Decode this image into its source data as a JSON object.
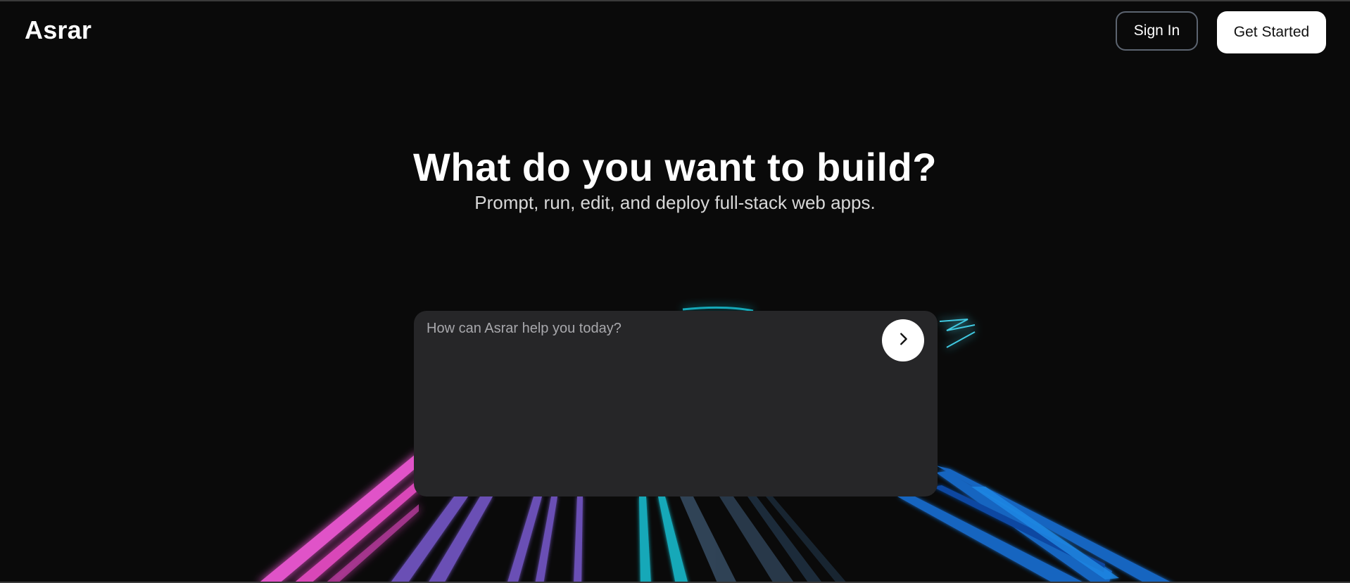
{
  "header": {
    "logo": "Asrar",
    "sign_in_label": "Sign In",
    "get_started_label": "Get Started"
  },
  "hero": {
    "title": "What do you want to build?",
    "subtitle": "Prompt, run, edit, and deploy full-stack web apps."
  },
  "prompt": {
    "placeholder": "How can Asrar help you today?",
    "value": "",
    "send_icon": "chevron-right-icon"
  },
  "colors": {
    "background": "#0a0a0a",
    "prompt_box": "#262628",
    "streak_pink": "#e052c8",
    "streak_purple": "#6b4fb5",
    "streak_teal": "#12a8b8",
    "streak_slate": "#34495e",
    "streak_blue": "#1565c0"
  }
}
